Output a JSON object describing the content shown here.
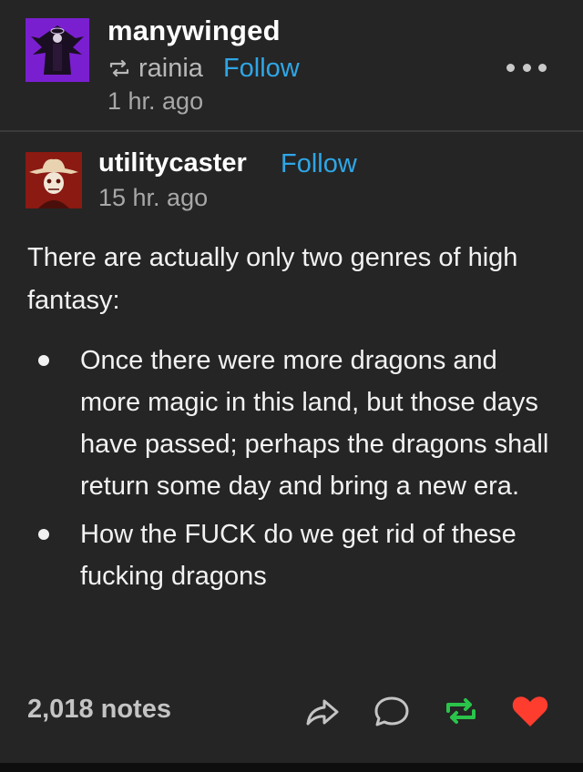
{
  "reblogger": {
    "username": "manywinged",
    "reblogged_from": "rainia",
    "follow_label": "Follow",
    "timestamp": "1 hr. ago"
  },
  "original": {
    "username": "utilitycaster",
    "follow_label": "Follow",
    "timestamp": "15 hr. ago"
  },
  "post": {
    "intro": "There are actually only two genres of high fantasy:",
    "bullets": [
      "Once there were more dragons and more magic in this land, but those days have passed; perhaps the dragons shall return some day and bring a new era.",
      "How the FUCK do we get rid of these fucking dragons"
    ]
  },
  "footer": {
    "notes": "2,018 notes",
    "icons": [
      "share-icon",
      "reply-icon",
      "reblog-icon",
      "heart-icon"
    ]
  },
  "colors": {
    "background": "#252525",
    "link": "#2fa6e6",
    "reblog_green": "#2bc44a",
    "heart_red": "#ff3d2e"
  }
}
